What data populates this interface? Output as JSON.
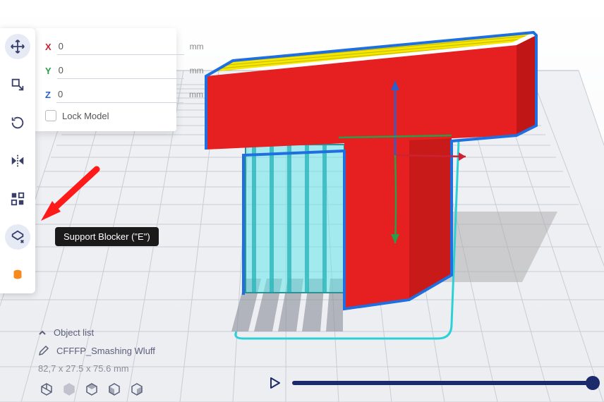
{
  "transform": {
    "x": "0",
    "y": "0",
    "z": "0",
    "unit": "mm",
    "lock_label": "Lock Model"
  },
  "tooltip": {
    "support_blocker": "Support Blocker (\"E\")"
  },
  "object_list": {
    "title": "Object list",
    "item": "CFFFP_Smashing Wluff",
    "dimensions": "82,7 x 27.5 x 75.6 mm"
  },
  "tools": {
    "move": "move-tool",
    "scale": "scale-tool",
    "rotate": "rotate-tool",
    "mirror": "mirror-tool",
    "mesh": "per-model-settings-tool",
    "support_blocker": "support-blocker-tool",
    "custom": "custom-supports-tool"
  },
  "colors": {
    "accent": "#1a2a6a",
    "model_red": "#e62020",
    "model_blue": "#1f6fe0",
    "support_cyan": "#4be0e5",
    "top_yellow": "#f7e600",
    "arrow_red": "#ff1a1a"
  }
}
